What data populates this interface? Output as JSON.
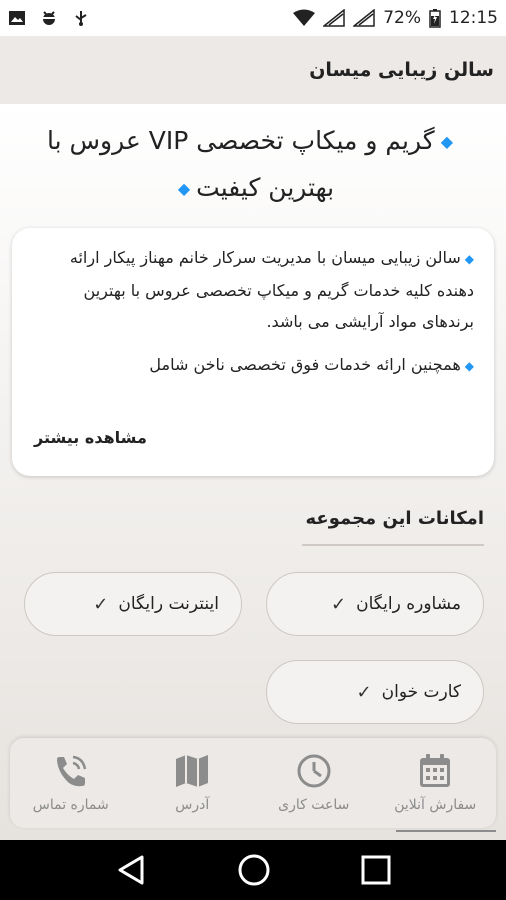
{
  "status_bar": {
    "battery": "72%",
    "time": "12:15",
    "icons": [
      "image-icon",
      "android-bug-icon",
      "usb-icon",
      "wifi-icon",
      "signal-1-icon",
      "signal-2-icon",
      "battery-charging-icon"
    ]
  },
  "app_bar": {
    "title": "سالن زیبایی میسان"
  },
  "headline": {
    "line1": "گریم و میکاپ تخصصی VIP عروس با",
    "line2": "بهترین کیفیت"
  },
  "intro_card": {
    "paragraph1": "سالن زیبایی میسان با مدیریت سرکار خانم مهناز پیکار ارائه دهنده کلیه خدمات گریم و میکاپ تخصصی عروس با بهترین برندهای مواد آرایشی می باشد.",
    "paragraph2": "همچنین ارائه خدمات فوق تخصصی ناخن شامل",
    "more_label": "مشاهده بیشتر"
  },
  "features": {
    "title": "امکانات این مجموعه",
    "items": [
      {
        "label": "مشاوره رایگان"
      },
      {
        "label": "اینترنت رایگان"
      },
      {
        "label": "کارت خوان"
      }
    ]
  },
  "bottom_nav": {
    "items": [
      {
        "label": "سفارش آنلاین",
        "icon": "calendar-icon"
      },
      {
        "label": "ساعت کاری",
        "icon": "clock-icon"
      },
      {
        "label": "آدرس",
        "icon": "map-icon"
      },
      {
        "label": "شماره تماس",
        "icon": "phone-call-icon"
      }
    ]
  },
  "colors": {
    "accent": "#2196f3",
    "app_bar_bg": "#ece9e6",
    "nav_icon": "#8c8c8c"
  }
}
